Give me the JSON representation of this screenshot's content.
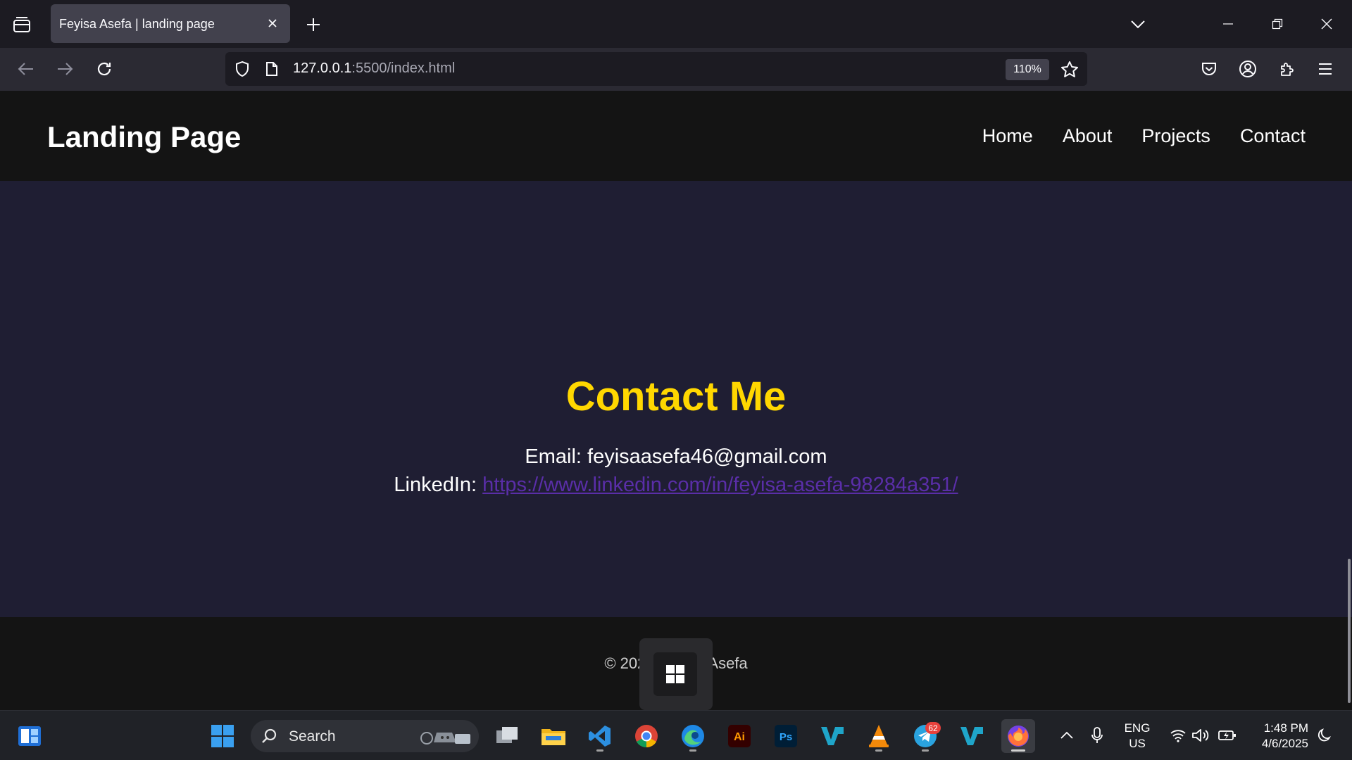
{
  "browser": {
    "tab": {
      "title": "Feyisa Asefa | landing page"
    },
    "url": {
      "host": "127.0.0.1",
      "path": ":5500/index.html"
    },
    "zoom": "110%"
  },
  "site": {
    "logo": "Landing Page",
    "nav": [
      "Home",
      "About",
      "Projects",
      "Contact"
    ],
    "contact": {
      "title": "Contact Me",
      "email_label": "Email: ",
      "email": "feyisaasefa46@gmail.com",
      "linkedin_label": "LinkedIn: ",
      "linkedin_url": "https://www.linkedin.com/in/feyisa-asefa-98284a351/"
    },
    "footer": "© 2025 Feyisa Asefa"
  },
  "taskbar": {
    "search_label": "Search",
    "telegram_badge": "62",
    "language": {
      "line1": "ENG",
      "line2": "US"
    },
    "clock": {
      "time": "1:48 PM",
      "date": "4/6/2025"
    }
  },
  "colors": {
    "page_bg": "#1f1e33",
    "header_bg": "#141414",
    "accent_yellow": "#ffd700",
    "link_purple": "#5a2ea8"
  }
}
